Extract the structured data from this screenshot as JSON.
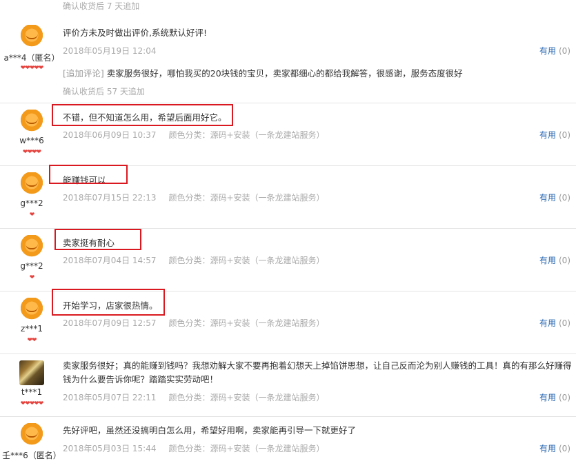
{
  "helpful_label": "有用",
  "reviews": [
    {
      "confirm_top": "确认收货后 7 天追加"
    },
    {
      "user": "a***4（匿名）",
      "hearts": "❤❤❤❤❤",
      "content": "评价方未及时做出评价,系统默认好评!",
      "date": "2018年05月19日 12:04",
      "sku": "",
      "helpful_count": "(0)",
      "append_label": "[追加评论]",
      "append_text": "卖家服务很好，哪怕我买的20块钱的宝贝，卖家都细心的都给我解答，很感谢，服务态度很好",
      "append_note": "确认收货后 57 天追加"
    },
    {
      "user": "w***6",
      "hearts": "❤❤❤❤",
      "content": "不错，但不知道怎么用，希望后面用好它。",
      "date": "2018年06月09日 10:37",
      "sku": "颜色分类：源码+安装（一条龙建站服务）",
      "helpful_count": "(0)"
    },
    {
      "user": "g***2",
      "hearts": "❤",
      "content": "能赚钱可以",
      "date": "2018年07月15日 22:13",
      "sku": "颜色分类：源码+安装（一条龙建站服务）",
      "helpful_count": "(0)"
    },
    {
      "user": "g***2",
      "hearts": "❤",
      "content": "卖家挺有耐心",
      "date": "2018年07月04日 14:57",
      "sku": "颜色分类：源码+安装（一条龙建站服务）",
      "helpful_count": "(0)"
    },
    {
      "user": "z***1",
      "hearts": "❤❤",
      "content": "开始学习，店家很热情。",
      "date": "2018年07月09日 12:57",
      "sku": "颜色分类：源码+安装（一条龙建站服务）",
      "helpful_count": "(0)"
    },
    {
      "user": "t***1",
      "hearts": "❤❤❤❤❤",
      "content": "卖家服务很好；真的能赚到钱吗？我想劝解大家不要再抱着幻想天上掉馅饼思想，让自己反而沦为别人赚钱的工具！真的有那么好赚得钱为什么要告诉你呢？踏踏实实劳动吧！",
      "date": "2018年05月07日 22:11",
      "sku": "颜色分类：源码+安装（一条龙建站服务）",
      "helpful_count": "(0)"
    },
    {
      "user": "壬***6（匿名）",
      "hearts": "",
      "content": "先好评吧，虽然还没搞明白怎么用，希望好用啊，卖家能再引导一下就更好了",
      "date": "2018年05月03日 15:44",
      "sku": "颜色分类：源码+安装（一条龙建站服务）",
      "helpful_count": "(0)"
    }
  ]
}
